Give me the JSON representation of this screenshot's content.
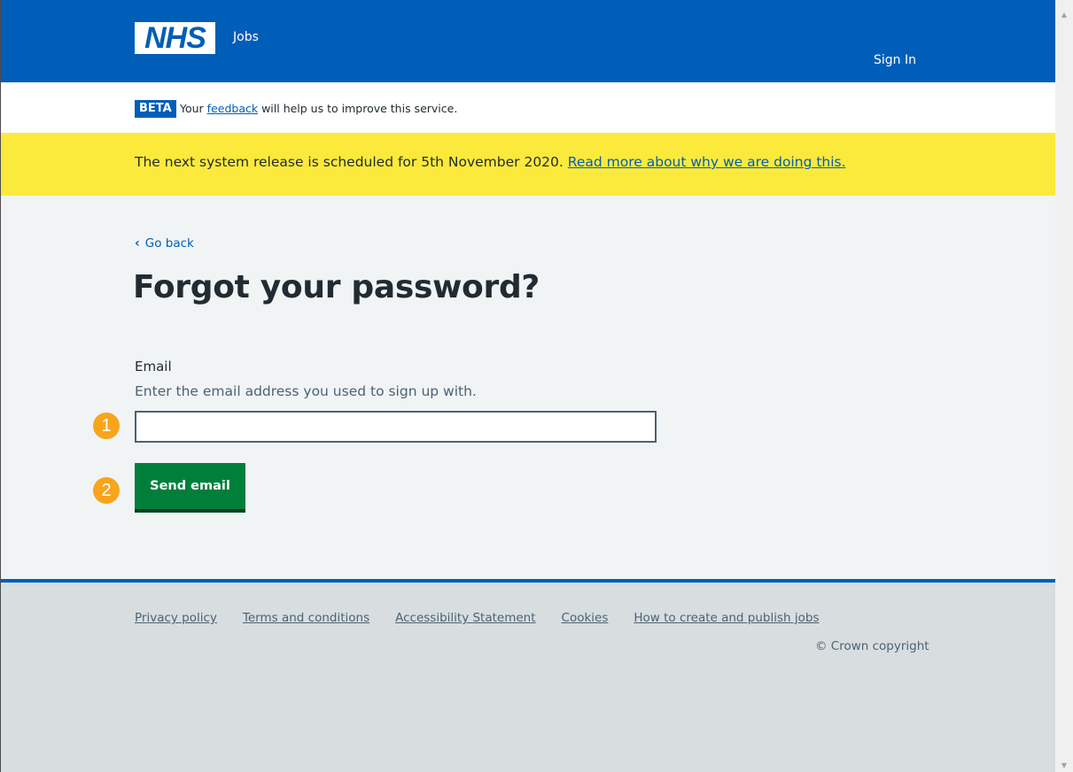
{
  "header": {
    "logo_text": "NHS",
    "service_name": "Jobs",
    "sign_in": "Sign In"
  },
  "beta": {
    "tag": "BETA",
    "text_before": "Your",
    "link": "feedback",
    "text_after": "will help us to improve this service."
  },
  "notice": {
    "text": "The next system release is scheduled for 5th November 2020.",
    "link": "Read more about why we are doing this."
  },
  "main": {
    "back_link": "Go back",
    "title": "Forgot your password?",
    "email_label": "Email",
    "email_hint": "Enter the email address you used to sign up with.",
    "email_value": "",
    "submit_label": "Send email"
  },
  "markers": [
    "1",
    "2"
  ],
  "footer": {
    "links": [
      "Privacy policy",
      "Terms and conditions",
      "Accessibility Statement",
      "Cookies",
      "How to create and publish jobs"
    ],
    "copyright": "© Crown copyright"
  },
  "colors": {
    "nhs_blue": "#005eb8",
    "notice_yellow": "#fbea3c",
    "button_green": "#007f3b",
    "marker_orange": "#f8a51c",
    "page_background": "#f0f4f5",
    "footer_background": "#d8dde0"
  },
  "icons": {
    "back": "chevron-left-icon",
    "scroll_up": "arrow-up-icon",
    "scroll_down": "arrow-down-icon"
  }
}
